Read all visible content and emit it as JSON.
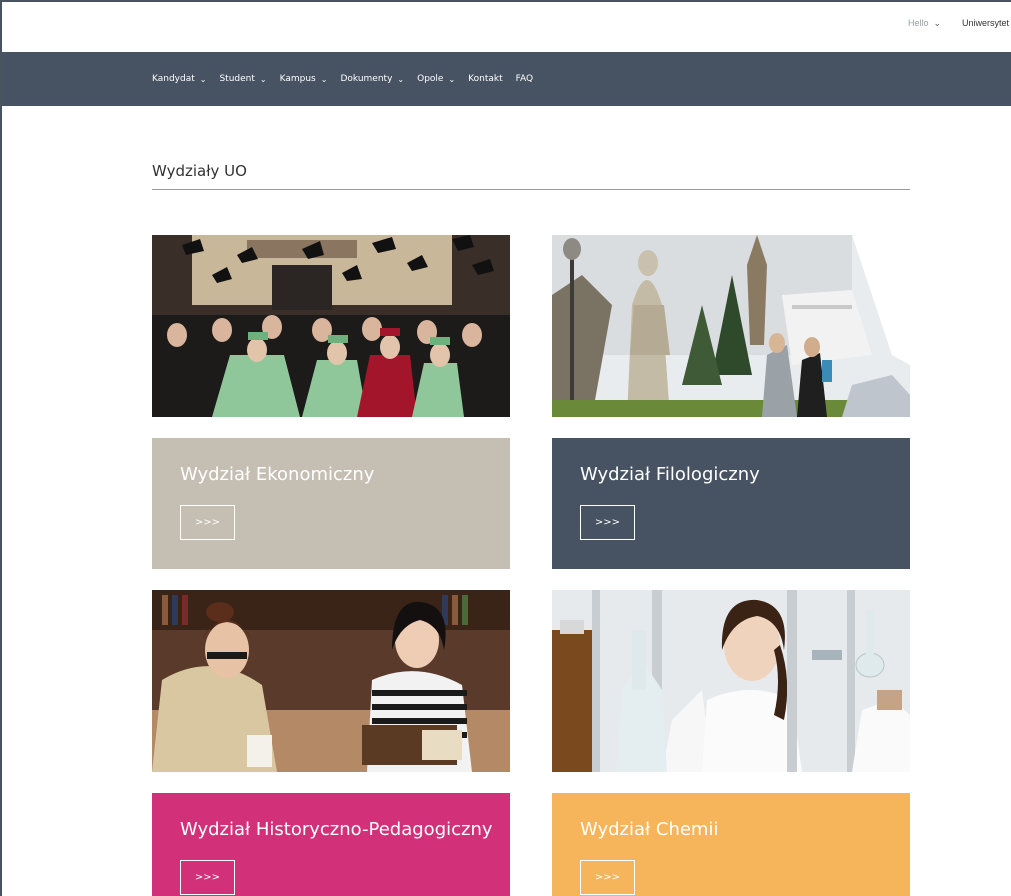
{
  "topbar": {
    "hello_label": "Hello",
    "hello_chevron": "⌄",
    "university_label": "Uniwersytet"
  },
  "nav": {
    "items": [
      {
        "label": "Kandydat",
        "chevron": "⌄"
      },
      {
        "label": "Student",
        "chevron": "⌄"
      },
      {
        "label": "Kampus",
        "chevron": "⌄"
      },
      {
        "label": "Dokumenty",
        "chevron": "⌄"
      },
      {
        "label": "Opole",
        "chevron": "⌄"
      },
      {
        "label": "Kontakt",
        "chevron": ""
      },
      {
        "label": "FAQ",
        "chevron": ""
      }
    ]
  },
  "page": {
    "title": "Wydziały UO"
  },
  "faculties": [
    {
      "name": "Wydział Ekonomiczny",
      "button": ">>>",
      "color": "#c5beb2",
      "photo": "graduation-ceremony-photo"
    },
    {
      "name": "Wydział Filologiczny",
      "button": ">>>",
      "color": "#475262",
      "photo": "statue-campus-photo"
    },
    {
      "name": "Wydział Historyczno-Pedagogiczny",
      "button": ">>>",
      "color": "#d3307a",
      "photo": "students-reading-library-photo"
    },
    {
      "name": "Wydział Chemii",
      "button": ">>>",
      "color": "#f6b55a",
      "photo": "chemistry-lab-photo"
    }
  ],
  "colors": {
    "navbar": "#475262",
    "rule": "#9c9c9c"
  }
}
